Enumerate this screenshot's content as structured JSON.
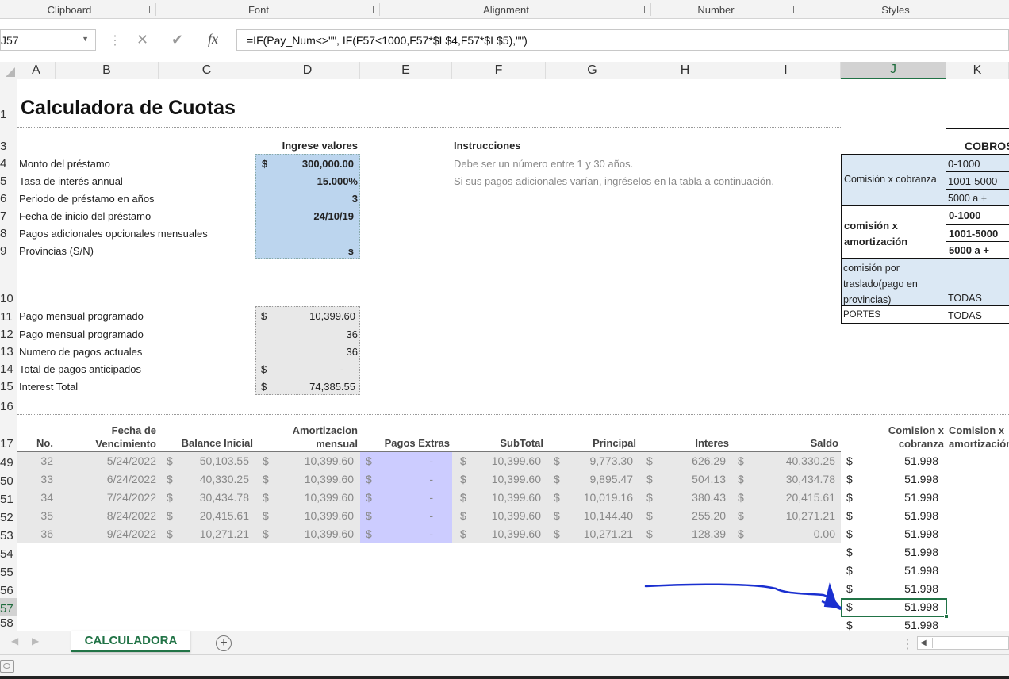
{
  "ribbon": {
    "groups": [
      "Clipboard",
      "Font",
      "Alignment",
      "Number",
      "Styles"
    ]
  },
  "formula_bar": {
    "name_box": "J57",
    "cancel_icon": "✕",
    "enter_icon": "✔",
    "fx_label": "fx",
    "formula": "=IF(Pay_Num<>\"\", IF(F57<1000,F57*$L$4,F57*$L$5),\"\")"
  },
  "columns": [
    "A",
    "B",
    "C",
    "D",
    "E",
    "F",
    "G",
    "H",
    "I",
    "J",
    "K"
  ],
  "selected_column": "J",
  "row_numbers": [
    "1",
    "3",
    "4",
    "5",
    "6",
    "7",
    "8",
    "9",
    "10",
    "11",
    "12",
    "13",
    "14",
    "15",
    "16",
    "17",
    "49",
    "50",
    "51",
    "52",
    "53",
    "54",
    "55",
    "56",
    "57",
    "58"
  ],
  "title": "Calculadora de Cuotas",
  "inputs": {
    "header": "Ingrese valores",
    "rows": [
      {
        "label": "Monto del préstamo",
        "cur": "$",
        "value": "300,000.00"
      },
      {
        "label": "Tasa de interés annual",
        "cur": "",
        "value": "15.000%"
      },
      {
        "label": "Periodo de préstamo en años",
        "cur": "",
        "value": "3"
      },
      {
        "label": "Fecha de inicio del préstamo",
        "cur": "",
        "value": "24/10/19"
      },
      {
        "label": "Pagos adicionales opcionales mensuales",
        "cur": "",
        "value": ""
      },
      {
        "label": "Provincias (S/N)",
        "cur": "",
        "value": "s"
      }
    ]
  },
  "instructions": {
    "header": "Instrucciones",
    "line1": "Debe ser un número entre 1 y 30 años.",
    "line2": "Si sus pagos adicionales varían, ingréselos en la tabla a continuación."
  },
  "summary": [
    {
      "label": "Pago mensual programado",
      "cur": "$",
      "value": "10,399.60"
    },
    {
      "label": "Pago mensual programado",
      "cur": "",
      "value": "36"
    },
    {
      "label": "Numero de pagos actuales",
      "cur": "",
      "value": "36"
    },
    {
      "label": "Total de pagos anticipados",
      "cur": "$",
      "value": "-"
    },
    {
      "label": "Interest Total",
      "cur": "$",
      "value": "74,385.55"
    }
  ],
  "cobros": {
    "header": "COBROS",
    "cobranza_label": "Comisión x cobranza",
    "cobranza_ranges": [
      "0-1000",
      "1001-5000",
      "5000 a +"
    ],
    "amort_label": "comisión x amortización",
    "amort_ranges": [
      "0-1000",
      "1001-5000",
      "5000 a +"
    ],
    "traslado_label": "comisión por traslado(pago en provincias)",
    "traslado_value": "TODAS",
    "portes_label": "PORTES",
    "portes_value": "TODAS"
  },
  "table": {
    "headers": {
      "no": "No.",
      "fecha": "Fecha de Vencimiento",
      "balance": "Balance Inicial",
      "amort": "Amortizacion mensual",
      "extras": "Pagos Extras",
      "subtotal": "SubTotal",
      "principal": "Principal",
      "interes": "Interes",
      "saldo": "Saldo",
      "comision": "Comision x cobranza",
      "comision_amort": "Comision x amortización"
    },
    "rows": [
      {
        "no": "32",
        "fecha": "5/24/2022",
        "balance": "50,103.55",
        "amort": "10,399.60",
        "extras": "-",
        "subtotal": "10,399.60",
        "principal": "9,773.30",
        "interes": "626.29",
        "saldo": "40,330.25",
        "comision": "51.998"
      },
      {
        "no": "33",
        "fecha": "6/24/2022",
        "balance": "40,330.25",
        "amort": "10,399.60",
        "extras": "-",
        "subtotal": "10,399.60",
        "principal": "9,895.47",
        "interes": "504.13",
        "saldo": "30,434.78",
        "comision": "51.998"
      },
      {
        "no": "34",
        "fecha": "7/24/2022",
        "balance": "30,434.78",
        "amort": "10,399.60",
        "extras": "-",
        "subtotal": "10,399.60",
        "principal": "10,019.16",
        "interes": "380.43",
        "saldo": "20,415.61",
        "comision": "51.998"
      },
      {
        "no": "35",
        "fecha": "8/24/2022",
        "balance": "20,415.61",
        "amort": "10,399.60",
        "extras": "-",
        "subtotal": "10,399.60",
        "principal": "10,144.40",
        "interes": "255.20",
        "saldo": "10,271.21",
        "comision": "51.998"
      },
      {
        "no": "36",
        "fecha": "9/24/2022",
        "balance": "10,271.21",
        "amort": "10,399.60",
        "extras": "-",
        "subtotal": "10,399.60",
        "principal": "10,271.21",
        "interes": "128.39",
        "saldo": "0.00",
        "comision": "51.998"
      }
    ],
    "extra_commissions": [
      "51.998",
      "51.998",
      "51.998",
      "51.998",
      "51.998"
    ],
    "currency": "$"
  },
  "sheet_tabs": {
    "active": "CALCULADORA",
    "add_icon": "+"
  },
  "colors": {
    "excel_green": "#217346",
    "input_blue": "#bcd5ee",
    "extras_lavender": "#ccccff",
    "annotation_ink": "#1a2fd0"
  }
}
